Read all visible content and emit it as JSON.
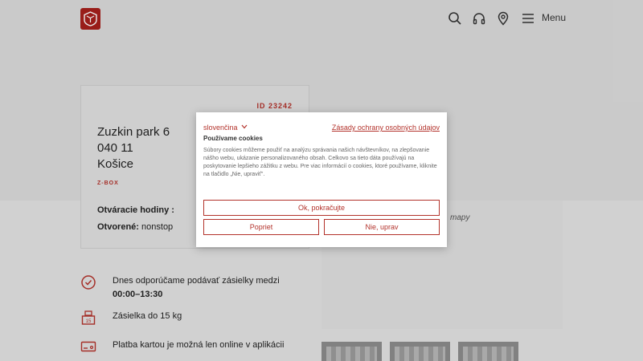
{
  "header": {
    "menu_label": "Menu",
    "icons": [
      "search-icon",
      "headphones-icon",
      "location-pin-icon",
      "hamburger-icon"
    ],
    "accent": "#b3322b"
  },
  "location_card": {
    "id_label": "ID 23242",
    "address_line1": "Zuzkin park 6",
    "address_line2": "040 11",
    "address_line3": "Košice",
    "type_label": "Z-BOX",
    "hours_title": "Otváracie hodiny :",
    "opened_label": "Otvorené:",
    "opened_value": "nonstop"
  },
  "map": {
    "partial_text": "mapy"
  },
  "info": {
    "recommend_text": "Dnes odporúčame podávať zásielky medzi",
    "recommend_time": "00:00–13:30",
    "weight_text": "Zásielka do 15 kg",
    "weight_icon_number": "15",
    "payment_text": "Platba kartou je možná len online v aplikácii"
  },
  "cookie_dialog": {
    "language": "slovenčina",
    "policy_link": "Zásady ochrany osobných údajov",
    "title": "Používame cookies",
    "body": "Súbory cookies môžeme použiť na analýzu správania našich návštevníkov, na zlepšovanie nášho webu, ukázanie personalizovaného obsah. Celkovo sa tieto dáta používajú na poskytovanie lepšieho zážitku z webu. Pre viac informácií o cookies, ktoré používame, kliknite na tlačidlo „Nie, upraviť\".",
    "accept_label": "Ok, pokračujte",
    "reject_label": "Popriet",
    "settings_label": "Nie, uprav"
  }
}
